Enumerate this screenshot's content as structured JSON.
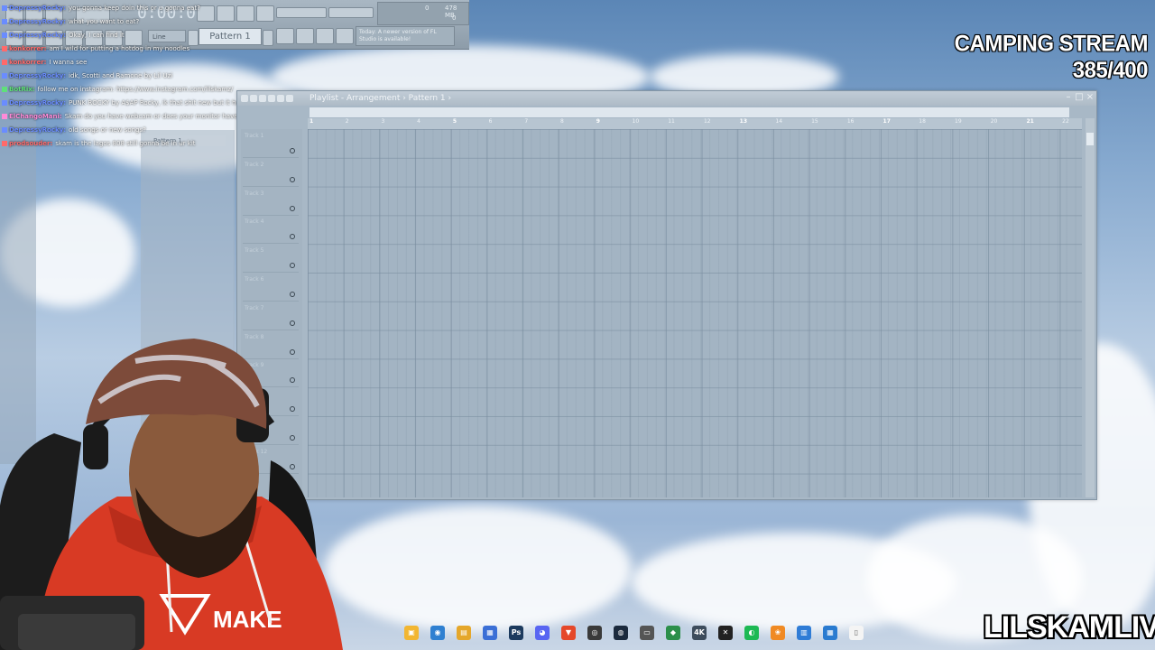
{
  "fl_toolbar": {
    "time": "0:00:00",
    "snap": "Line",
    "pattern": "Pattern 1",
    "cpu_number": "0",
    "memory": "478 MB",
    "zero": "0",
    "news": "Today: A newer version of FL Studio is available!"
  },
  "browser": {
    "item": "Pattern 1"
  },
  "chat": [
    {
      "user": "DepressyRocky",
      "color": "#6a8cff",
      "text": "you gonna keep doin this or u gonna eat?"
    },
    {
      "user": "DepressyRocky",
      "color": "#6a8cff",
      "text": "what you want to eat?"
    },
    {
      "user": "DepressyRocky",
      "color": "#6a8cff",
      "text": "Okay, I can find it"
    },
    {
      "user": "konkorrer",
      "color": "#ff6a6a",
      "text": "am I wild for putting a hotdog in my noodles"
    },
    {
      "user": "konkorrer",
      "color": "#ff6a6a",
      "text": "I wanna see"
    },
    {
      "user": "DepressyRocky",
      "color": "#6a8cff",
      "text": "idk, Scotti and Ramone by Lil Uzi"
    },
    {
      "user": "BotRix",
      "color": "#5fe07a",
      "text": "follow me on instagram: https://www.instagram.com/lilskamz/"
    },
    {
      "user": "DepressyRocky",
      "color": "#6a8cff",
      "text": "PUNK ROCKY by A$AP Rocky, ik that shit new but it has melody"
    },
    {
      "user": "ElChangoMani",
      "color": "#ff8ad8",
      "text": "Skam do you have webcam or does your monitor have a camera ?"
    },
    {
      "user": "DepressyRocky",
      "color": "#6a8cff",
      "text": "old songs or new songs?"
    },
    {
      "user": "prodsouder",
      "color": "#ff6a6a",
      "text": "skam is the lagos 808 still gonna be in ur kit"
    }
  ],
  "playlist": {
    "title": "Playlist - Arrangement › Pattern 1 ›",
    "ruler": [
      "1",
      "2",
      "3",
      "4",
      "5",
      "6",
      "7",
      "8",
      "9",
      "10",
      "11",
      "12",
      "13",
      "14",
      "15",
      "16",
      "17",
      "18",
      "19",
      "20",
      "21",
      "22"
    ],
    "tracks": [
      "Track 1",
      "Track 2",
      "Track 3",
      "Track 4",
      "Track 5",
      "Track 6",
      "Track 7",
      "Track 8",
      "Track 9",
      "Track 10",
      "Track 11",
      "Track 12"
    ]
  },
  "overlay": {
    "stream_title": "CAMPING STREAM 385/400",
    "channel": "LILSKAMLIVE"
  },
  "taskbar": {
    "icons": [
      {
        "name": "file-explorer-icon",
        "color": "#f2b632",
        "glyph": "▣"
      },
      {
        "name": "chrome-icon",
        "color": "#2f80d1",
        "glyph": "◉"
      },
      {
        "name": "folder-icon",
        "color": "#e5a72b",
        "glyph": "▤"
      },
      {
        "name": "store-icon",
        "color": "#3b6fd6",
        "glyph": "▦"
      },
      {
        "name": "photoshop-icon",
        "color": "#1c3a5e",
        "glyph": "Ps"
      },
      {
        "name": "discord-icon",
        "color": "#5865f2",
        "glyph": "◕"
      },
      {
        "name": "brave-icon",
        "color": "#e5482a",
        "glyph": "▼"
      },
      {
        "name": "obs-icon",
        "color": "#3a3a3a",
        "glyph": "◎"
      },
      {
        "name": "steam-icon",
        "color": "#1b2a3d",
        "glyph": "◍"
      },
      {
        "name": "keyboard-icon",
        "color": "#555555",
        "glyph": "▭"
      },
      {
        "name": "layers-icon",
        "color": "#2c8f4a",
        "glyph": "◆"
      },
      {
        "name": "4k-icon",
        "color": "#3d4c5c",
        "glyph": "4K"
      },
      {
        "name": "capcut-icon",
        "color": "#222222",
        "glyph": "✕"
      },
      {
        "name": "spotify-icon",
        "color": "#1db954",
        "glyph": "◐"
      },
      {
        "name": "fl-studio-icon",
        "color": "#f08a24",
        "glyph": "❀"
      },
      {
        "name": "notepad-icon",
        "color": "#2f7cd6",
        "glyph": "▥"
      },
      {
        "name": "calendar-icon",
        "color": "#2a7bd0",
        "glyph": "▦"
      },
      {
        "name": "document-icon",
        "color": "#f4f4f4",
        "glyph": "▯"
      }
    ]
  }
}
